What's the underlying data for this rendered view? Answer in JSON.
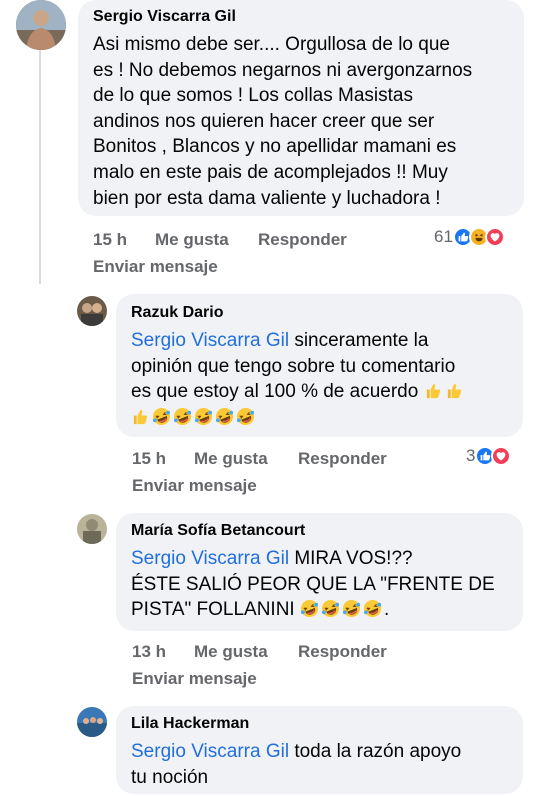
{
  "comments": [
    {
      "author": "Sergio Viscarra Gil",
      "mention": "",
      "lines": [
        "Asi mismo debe ser.... Orgullosa de lo que",
        "es ! No debemos negarnos ni avergonzarnos",
        "de lo que somos ! Los collas Masistas",
        "andinos nos quieren hacer creer que ser",
        "Bonitos , Blancos y no apellidar mamani es",
        "malo en este pais de acomplejados !! Muy",
        "bien por esta dama valiente y luchadora !"
      ],
      "time": "15 h",
      "like": "Me gusta",
      "reply": "Responder",
      "send": "Enviar mensaje",
      "reaction_count": "61",
      "reactions": [
        "like-reaction-icon",
        "haha-reaction-icon",
        "love-reaction-icon"
      ]
    },
    {
      "author": "Razuk Dario",
      "mention": "Sergio Viscarra Gil",
      "lines": [
        " sinceramente la",
        "opinión que tengo sobre tu comentario",
        "es que estoy al 100 % de acuerdo "
      ],
      "emoji_line_1": [
        "thumbs-up-emoji",
        "thumbs-up-emoji"
      ],
      "emoji_line_2": [
        "thumbs-up-emoji",
        "rolling-laugh-emoji",
        "rolling-laugh-emoji",
        "rolling-laugh-emoji",
        "rolling-laugh-emoji",
        "rolling-laugh-emoji"
      ],
      "time": "15 h",
      "like": "Me gusta",
      "reply": "Responder",
      "send": "Enviar mensaje",
      "reaction_count": "3",
      "reactions": [
        "like-reaction-icon",
        "love-reaction-icon"
      ]
    },
    {
      "author": "María Sofía Betancourt",
      "mention": "Sergio Viscarra Gil",
      "lines": [
        " MIRA VOS!??",
        "ÉSTE SALIÓ PEOR QUE LA \"FRENTE DE",
        "PISTA\" FOLLANINI "
      ],
      "emoji_line_3": [
        "rolling-laugh-emoji",
        "rolling-laugh-emoji",
        "rolling-laugh-emoji",
        "rolling-laugh-emoji"
      ],
      "end_text": ".",
      "time": "13 h",
      "like": "Me gusta",
      "reply": "Responder",
      "send": "Enviar mensaje"
    },
    {
      "author": "Lila Hackerman",
      "mention": "Sergio Viscarra Gil",
      "lines": [
        " toda la razón apoyo",
        "tu noción"
      ]
    }
  ],
  "colors": {
    "bubble": "#f0f2f5",
    "mention": "#216fdb",
    "meta": "#65676b",
    "like_blue": "#1877f2",
    "love_red": "#f33e58",
    "haha_yellow": "#f7b125"
  }
}
